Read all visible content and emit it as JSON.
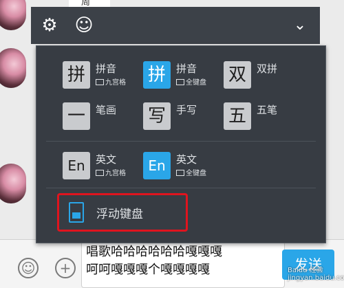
{
  "chat": {
    "top_bubble_text": "周"
  },
  "toolbar": {
    "settings_icon": "gear-icon",
    "emoji_icon": "smiley-icon",
    "collapse_icon": "chevron-down-icon",
    "settings_glyph": "⚙",
    "emoji_glyph": "☺",
    "collapse_glyph": "⌄"
  },
  "ime_options": [
    {
      "glyph": "拼",
      "label": "拼音",
      "sub": "九宫格",
      "active": false
    },
    {
      "glyph": "拼",
      "label": "拼音",
      "sub": "全键盘",
      "active": true
    },
    {
      "glyph": "双",
      "label": "双拼",
      "sub": "",
      "active": false
    },
    {
      "glyph": "一",
      "label": "笔画",
      "sub": "",
      "active": false
    },
    {
      "glyph": "写",
      "label": "手写",
      "sub": "",
      "active": false
    },
    {
      "glyph": "五",
      "label": "五笔",
      "sub": "",
      "active": false
    },
    {
      "glyph": "En",
      "label": "英文",
      "sub": "九宫格",
      "active": false
    },
    {
      "glyph": "En",
      "label": "英文",
      "sub": "全键盘",
      "active": true
    }
  ],
  "floating_keyboard": {
    "label": "浮动键盘",
    "icon": "floating-keyboard-icon"
  },
  "input": {
    "text_line1": "唱歌哈哈哈哈哈哈嘎嘎嘎",
    "text_line2": "呵呵嘎嘎嘎个嘎嘎嘎嘎"
  },
  "send_button": {
    "label": "发送"
  },
  "watermark": "Baidu 经验 jingyan.baidu.com",
  "colors": {
    "accent": "#2aa6e8",
    "panel_bg": "#373c43",
    "highlight_border": "#e0141e"
  }
}
